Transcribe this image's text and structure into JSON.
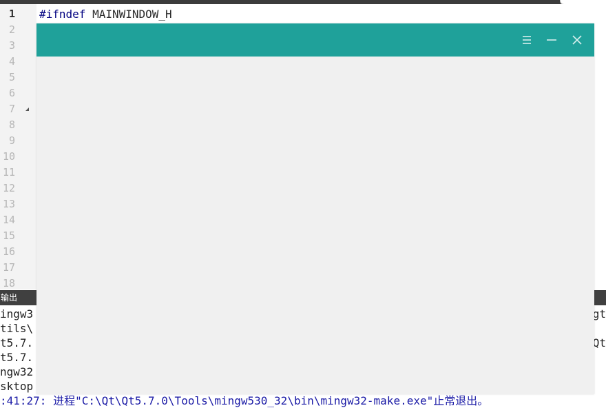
{
  "editor": {
    "line_numbers": [
      "1",
      "2",
      "3",
      "4",
      "5",
      "6",
      "7",
      "8",
      "9",
      "10",
      "11",
      "12",
      "13",
      "14",
      "15",
      "16",
      "17",
      "18"
    ],
    "code_keyword": "#ifndef",
    "code_rest": " MAINWINDOW_H"
  },
  "output": {
    "title": "输出",
    "left_lines": [
      "ingw3",
      "tils\\",
      "t5.7.",
      "t5.7.",
      "ngw32",
      "sktop"
    ],
    "right_lines": [
      "gt",
      "",
      "bQt",
      "",
      "",
      ""
    ],
    "final_line": ":41:27: 进程\"C:\\Qt\\Qt5.7.0\\Tools\\mingw530_32\\bin\\mingw32-make.exe\"止常退出。"
  },
  "window": {
    "titlebar_color": "#1fa19a",
    "buttons": [
      "menu-icon",
      "minimize-icon",
      "close-icon"
    ]
  }
}
